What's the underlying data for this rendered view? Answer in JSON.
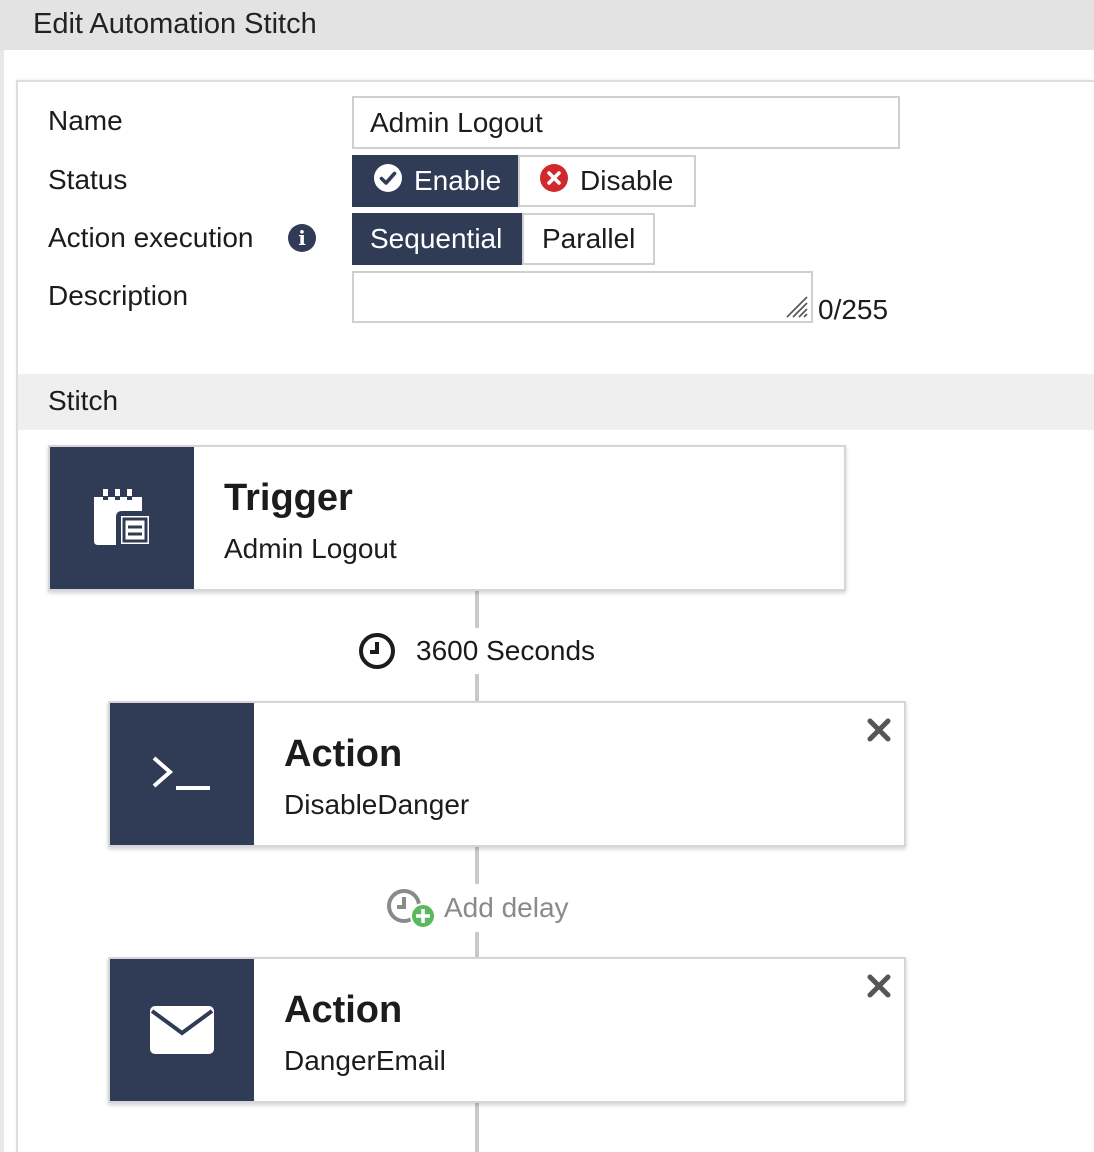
{
  "dialog": {
    "title": "Edit Automation Stitch"
  },
  "form": {
    "name_label": "Name",
    "name_value": "Admin Logout",
    "status_label": "Status",
    "status_enable": "Enable",
    "status_disable": "Disable",
    "status_selected": "Enable",
    "execution_label": "Action execution",
    "execution_sequential": "Sequential",
    "execution_parallel": "Parallel",
    "execution_selected": "Sequential",
    "description_label": "Description",
    "description_value": "",
    "description_count": "0/255"
  },
  "stitch": {
    "section_title": "Stitch",
    "trigger": {
      "title": "Trigger",
      "name": "Admin Logout",
      "icon": "calendar-icon"
    },
    "delay_1": "3600 Seconds",
    "action_1": {
      "title": "Action",
      "name": "DisableDanger",
      "icon": "terminal-icon"
    },
    "add_delay": "Add delay",
    "action_2": {
      "title": "Action",
      "name": "DangerEmail",
      "icon": "envelope-icon"
    }
  },
  "colors": {
    "accent": "#303b55",
    "danger": "#d0282c",
    "success": "#5cb85c"
  }
}
